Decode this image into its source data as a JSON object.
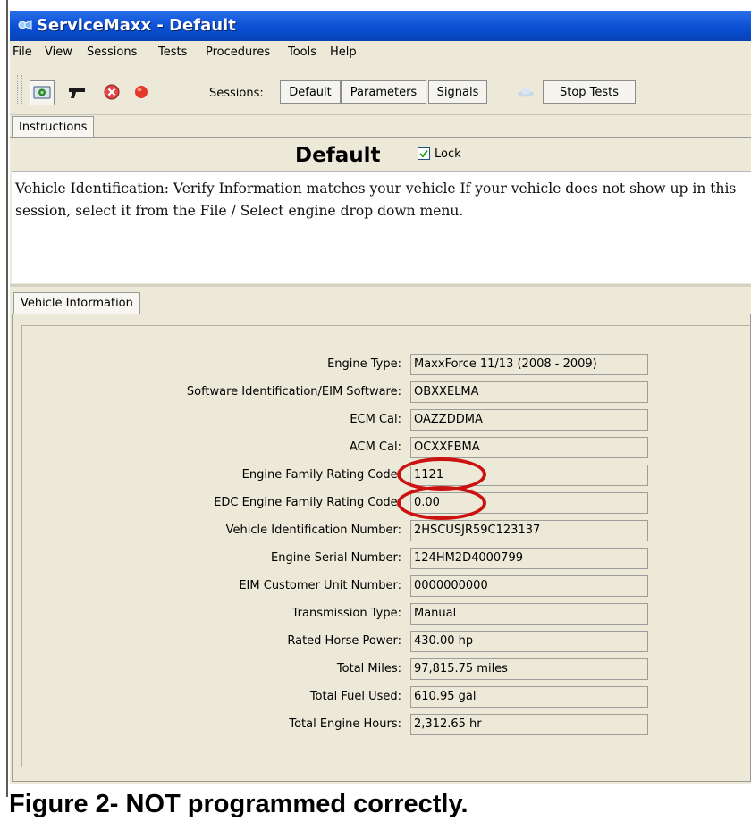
{
  "window": {
    "title": "ServiceMaxx - Default"
  },
  "menu": [
    "File",
    "View",
    "Sessions",
    "Tests",
    "Procedures",
    "Tools",
    "Help"
  ],
  "toolbar": {
    "sessions_label": "Sessions:",
    "default_button": "Default",
    "parameters_button": "Parameters",
    "signals_button": "Signals",
    "stop_tests_button": "Stop Tests"
  },
  "instructions": {
    "tab_label": "Instructions",
    "title": "Default",
    "lock_label": "Lock",
    "lock_checked": true,
    "text": "Vehicle Identification: Verify Information matches your vehicle If your vehicle does not show up in this session, select it from the File / Select engine drop down menu."
  },
  "vehicle_info": {
    "tab_label": "Vehicle Information",
    "fields": [
      {
        "label": "Engine Type:",
        "value": "MaxxForce 11/13 (2008 - 2009)"
      },
      {
        "label": "Software Identification/EIM Software:",
        "value": "OBXXELMA"
      },
      {
        "label": "ECM Cal:",
        "value": "OAZZDDMA"
      },
      {
        "label": "ACM Cal:",
        "value": "OCXXFBMA"
      },
      {
        "label": "Engine Family Rating Code:",
        "value": "1121"
      },
      {
        "label": "EDC Engine Family Rating Code:",
        "value": "0.00"
      },
      {
        "label": "Vehicle Identification Number:",
        "value": "2HSCUSJR59C123137"
      },
      {
        "label": "Engine Serial Number:",
        "value": "124HM2D4000799"
      },
      {
        "label": "EIM Customer Unit Number:",
        "value": "0000000000"
      },
      {
        "label": "Transmission Type:",
        "value": "Manual"
      },
      {
        "label": "Rated Horse Power:",
        "value": "430.00 hp"
      },
      {
        "label": "Total Miles:",
        "value": "97,815.75 miles"
      },
      {
        "label": "Total Fuel Used:",
        "value": "610.95 gal"
      },
      {
        "label": "Total Engine Hours:",
        "value": "2,312.65 hr"
      }
    ]
  },
  "caption": "Figure 2- NOT programmed correctly.",
  "colors": {
    "title_bar": "#0a4fd4",
    "annotation_circle": "#cc1111",
    "panel": "#ece9d8"
  }
}
